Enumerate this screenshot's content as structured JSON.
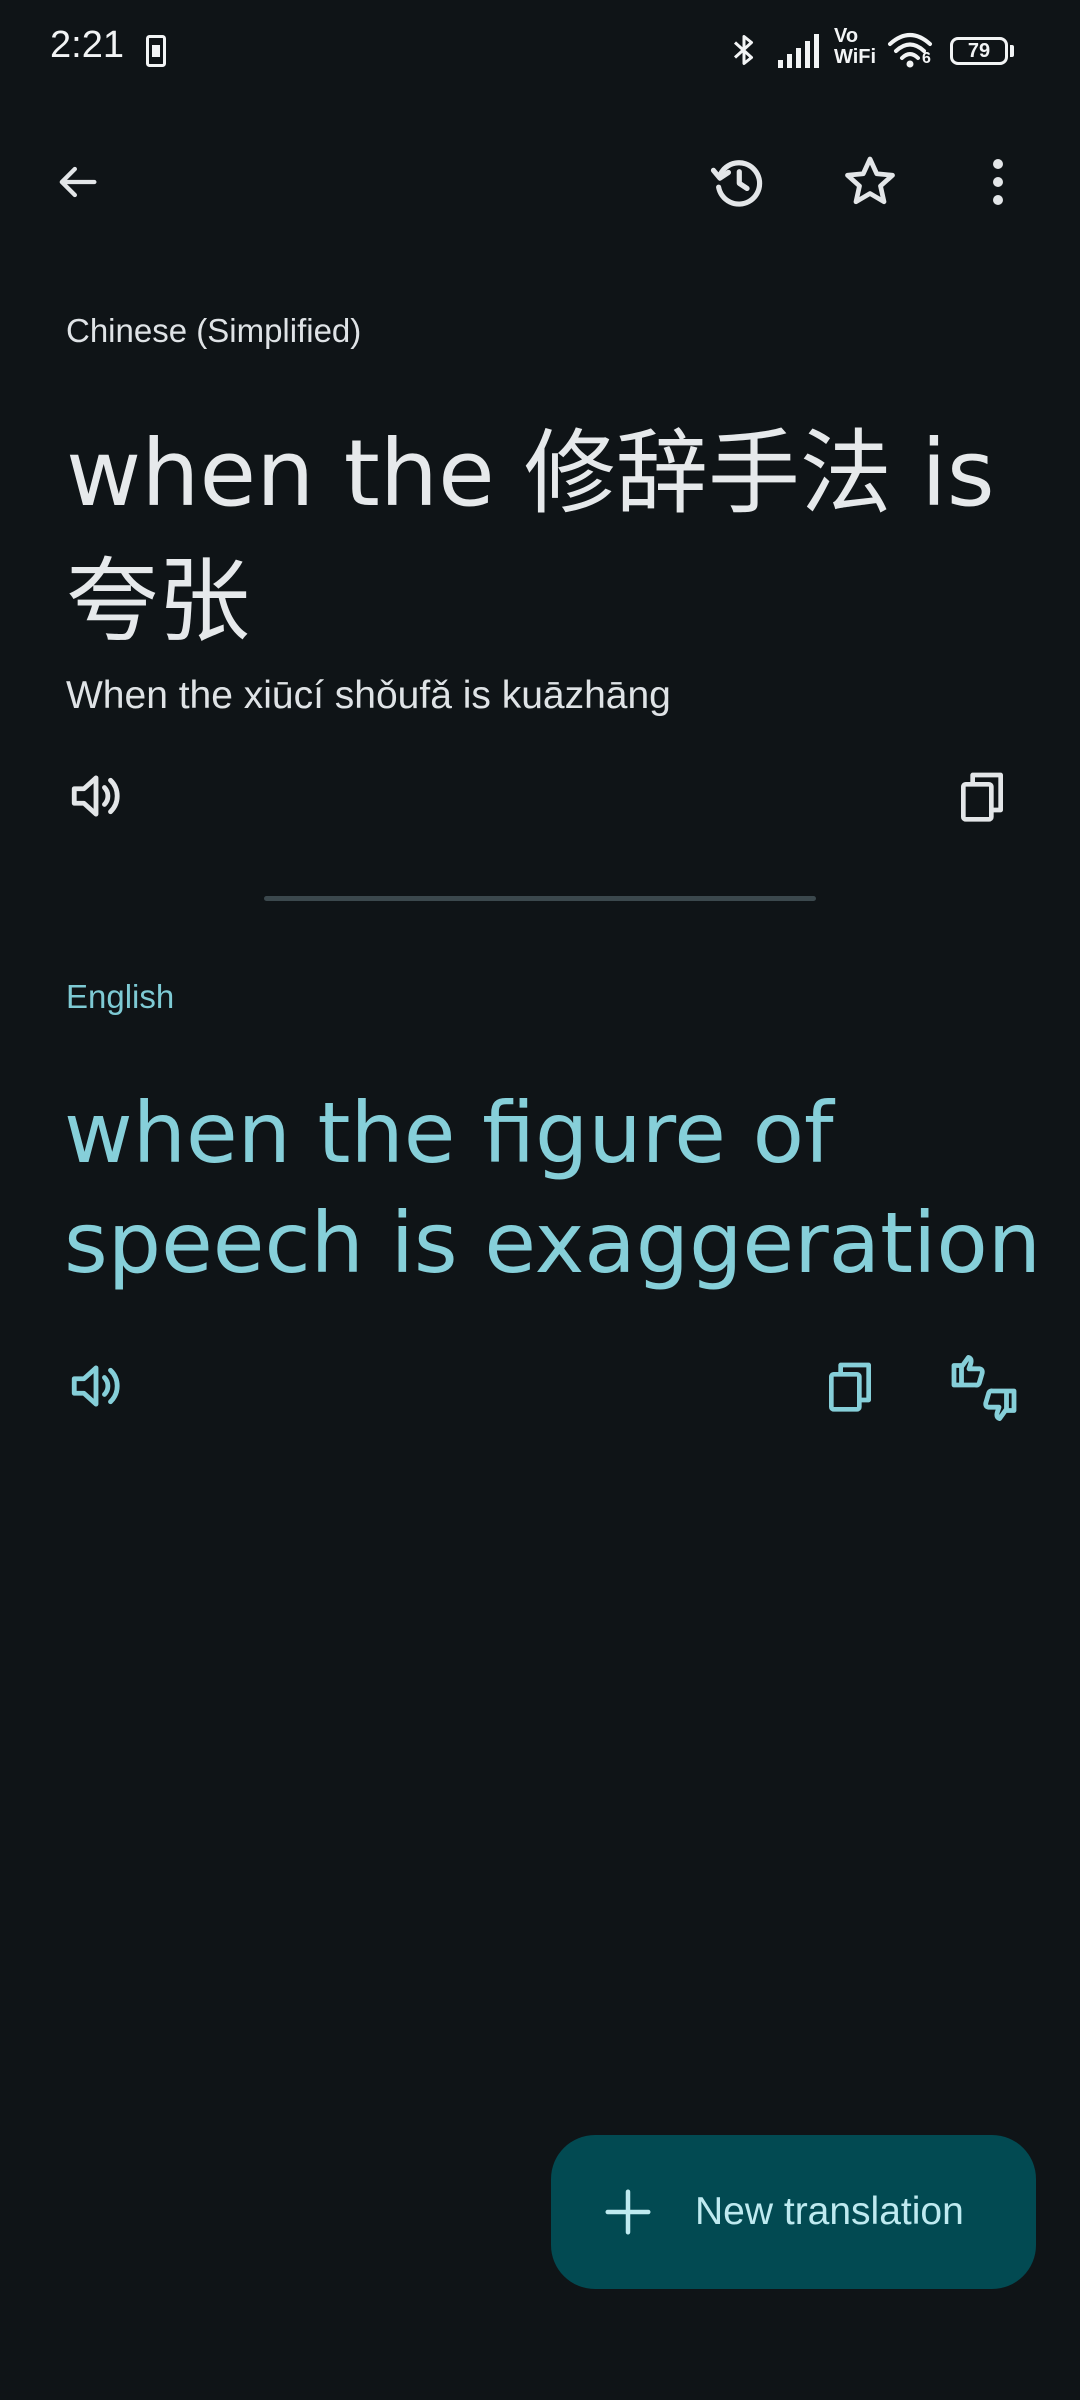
{
  "status_bar": {
    "time": "2:21",
    "network_label_top": "Vo",
    "network_label_bottom": "WiFi",
    "wifi_badge": "6",
    "battery": "79"
  },
  "toolbar": {
    "back_icon": "arrow-left-icon",
    "history_icon": "history-icon",
    "star_icon": "star-outline-icon",
    "more_icon": "more-vertical-icon"
  },
  "source": {
    "language": "Chinese (Simplified)",
    "text": "when the 修辞手法 is 夸张",
    "transliteration": "When the xiūcí shǒufǎ is kuāzhāng"
  },
  "target": {
    "language": "English",
    "text": "when the figure of speech is exaggeration"
  },
  "fab": {
    "label": "New translation",
    "icon": "plus-icon"
  },
  "colors": {
    "background": "#0f1417",
    "accent": "#86cfd9",
    "fab_bg": "#024a52"
  }
}
